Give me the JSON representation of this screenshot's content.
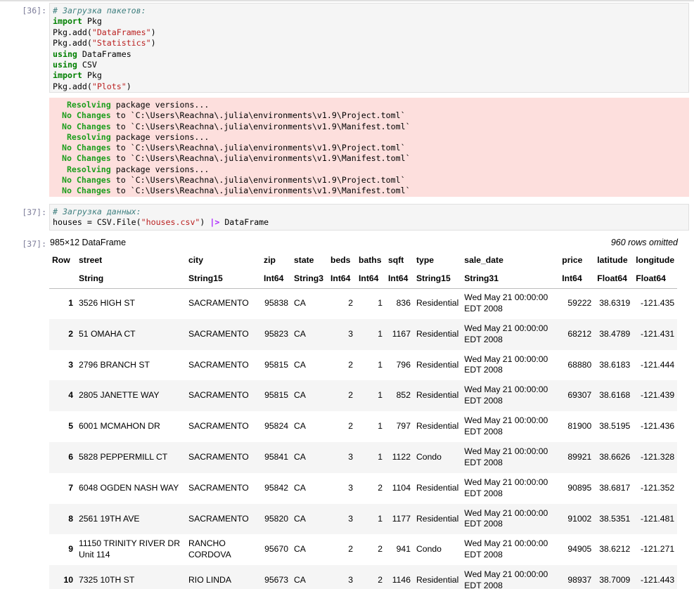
{
  "cell36": {
    "prompt": "[36]:",
    "code_lines": [
      [
        {
          "c": "cm",
          "t": "# Загрузка пакетов:"
        }
      ],
      [
        {
          "c": "kw",
          "t": "import"
        },
        {
          "c": "",
          "t": " Pkg"
        }
      ],
      [
        {
          "c": "",
          "t": "Pkg.add("
        },
        {
          "c": "st",
          "t": "\"DataFrames\""
        },
        {
          "c": "",
          "t": ")"
        }
      ],
      [
        {
          "c": "",
          "t": "Pkg.add("
        },
        {
          "c": "st",
          "t": "\"Statistics\""
        },
        {
          "c": "",
          "t": ")"
        }
      ],
      [
        {
          "c": "kw",
          "t": "using"
        },
        {
          "c": "",
          "t": " DataFrames"
        }
      ],
      [
        {
          "c": "kw",
          "t": "using"
        },
        {
          "c": "",
          "t": " CSV"
        }
      ],
      [
        {
          "c": "kw",
          "t": "import"
        },
        {
          "c": "",
          "t": " Pkg"
        }
      ],
      [
        {
          "c": "",
          "t": "Pkg.add("
        },
        {
          "c": "st",
          "t": "\"Plots\""
        },
        {
          "c": "",
          "t": ")"
        }
      ]
    ],
    "stderr_lines": [
      [
        {
          "c": "gb",
          "t": "   Resolving"
        },
        {
          "c": "",
          "t": " package versions..."
        }
      ],
      [
        {
          "c": "gb",
          "t": "  No Changes"
        },
        {
          "c": "",
          "t": " to `C:\\Users\\Reachna\\.julia\\environments\\v1.9\\Project.toml`"
        }
      ],
      [
        {
          "c": "gb",
          "t": "  No Changes"
        },
        {
          "c": "",
          "t": " to `C:\\Users\\Reachna\\.julia\\environments\\v1.9\\Manifest.toml`"
        }
      ],
      [
        {
          "c": "gb",
          "t": "   Resolving"
        },
        {
          "c": "",
          "t": " package versions..."
        }
      ],
      [
        {
          "c": "gb",
          "t": "  No Changes"
        },
        {
          "c": "",
          "t": " to `C:\\Users\\Reachna\\.julia\\environments\\v1.9\\Project.toml`"
        }
      ],
      [
        {
          "c": "gb",
          "t": "  No Changes"
        },
        {
          "c": "",
          "t": " to `C:\\Users\\Reachna\\.julia\\environments\\v1.9\\Manifest.toml`"
        }
      ],
      [
        {
          "c": "gb",
          "t": "   Resolving"
        },
        {
          "c": "",
          "t": " package versions..."
        }
      ],
      [
        {
          "c": "gb",
          "t": "  No Changes"
        },
        {
          "c": "",
          "t": " to `C:\\Users\\Reachna\\.julia\\environments\\v1.9\\Project.toml`"
        }
      ],
      [
        {
          "c": "gb",
          "t": "  No Changes"
        },
        {
          "c": "",
          "t": " to `C:\\Users\\Reachna\\.julia\\environments\\v1.9\\Manifest.toml`"
        }
      ]
    ]
  },
  "cell37": {
    "prompt": "[37]:",
    "out_prompt": "[37]:",
    "code_lines": [
      [
        {
          "c": "cm",
          "t": "# Загрузка данных:"
        }
      ],
      [
        {
          "c": "",
          "t": "houses = CSV.File("
        },
        {
          "c": "st",
          "t": "\"houses.csv\""
        },
        {
          "c": "",
          "t": ") "
        },
        {
          "c": "op",
          "t": "|>"
        },
        {
          "c": "",
          "t": " DataFrame"
        }
      ]
    ]
  },
  "dataframe": {
    "dims": "985×12 DataFrame",
    "omitted": "960 rows omitted",
    "columns": [
      {
        "name": "Row",
        "type": "",
        "align": "rn"
      },
      {
        "name": "street",
        "type": "String",
        "align": ""
      },
      {
        "name": "city",
        "type": "String15",
        "align": ""
      },
      {
        "name": "zip",
        "type": "Int64",
        "align": "num"
      },
      {
        "name": "state",
        "type": "String3",
        "align": ""
      },
      {
        "name": "beds",
        "type": "Int64",
        "align": "num"
      },
      {
        "name": "baths",
        "type": "Int64",
        "align": "num"
      },
      {
        "name": "sqft",
        "type": "Int64",
        "align": "num"
      },
      {
        "name": "type",
        "type": "String15",
        "align": ""
      },
      {
        "name": "sale_date",
        "type": "String31",
        "align": ""
      },
      {
        "name": "price",
        "type": "Int64",
        "align": "num"
      },
      {
        "name": "latitude",
        "type": "Float64",
        "align": "num"
      },
      {
        "name": "longitude",
        "type": "Float64",
        "align": "num"
      }
    ],
    "rows": [
      [
        "1",
        "3526 HIGH ST",
        "SACRAMENTO",
        "95838",
        "CA",
        "2",
        "1",
        "836",
        "Residential",
        "Wed May 21 00:00:00 EDT 2008",
        "59222",
        "38.6319",
        "-121.435"
      ],
      [
        "2",
        "51 OMAHA CT",
        "SACRAMENTO",
        "95823",
        "CA",
        "3",
        "1",
        "1167",
        "Residential",
        "Wed May 21 00:00:00 EDT 2008",
        "68212",
        "38.4789",
        "-121.431"
      ],
      [
        "3",
        "2796 BRANCH ST",
        "SACRAMENTO",
        "95815",
        "CA",
        "2",
        "1",
        "796",
        "Residential",
        "Wed May 21 00:00:00 EDT 2008",
        "68880",
        "38.6183",
        "-121.444"
      ],
      [
        "4",
        "2805 JANETTE WAY",
        "SACRAMENTO",
        "95815",
        "CA",
        "2",
        "1",
        "852",
        "Residential",
        "Wed May 21 00:00:00 EDT 2008",
        "69307",
        "38.6168",
        "-121.439"
      ],
      [
        "5",
        "6001 MCMAHON DR",
        "SACRAMENTO",
        "95824",
        "CA",
        "2",
        "1",
        "797",
        "Residential",
        "Wed May 21 00:00:00 EDT 2008",
        "81900",
        "38.5195",
        "-121.436"
      ],
      [
        "6",
        "5828 PEPPERMILL CT",
        "SACRAMENTO",
        "95841",
        "CA",
        "3",
        "1",
        "1122",
        "Condo",
        "Wed May 21 00:00:00 EDT 2008",
        "89921",
        "38.6626",
        "-121.328"
      ],
      [
        "7",
        "6048 OGDEN NASH WAY",
        "SACRAMENTO",
        "95842",
        "CA",
        "3",
        "2",
        "1104",
        "Residential",
        "Wed May 21 00:00:00 EDT 2008",
        "90895",
        "38.6817",
        "-121.352"
      ],
      [
        "8",
        "2561 19TH AVE",
        "SACRAMENTO",
        "95820",
        "CA",
        "3",
        "1",
        "1177",
        "Residential",
        "Wed May 21 00:00:00 EDT 2008",
        "91002",
        "38.5351",
        "-121.481"
      ],
      [
        "9",
        "11150 TRINITY RIVER DR Unit 114",
        "RANCHO CORDOVA",
        "95670",
        "CA",
        "2",
        "2",
        "941",
        "Condo",
        "Wed May 21 00:00:00 EDT 2008",
        "94905",
        "38.6212",
        "-121.271"
      ],
      [
        "10",
        "7325 10TH ST",
        "RIO LINDA",
        "95673",
        "CA",
        "3",
        "2",
        "1146",
        "Residential",
        "Wed May 21 00:00:00 EDT 2008",
        "98937",
        "38.7009",
        "-121.443"
      ]
    ]
  }
}
